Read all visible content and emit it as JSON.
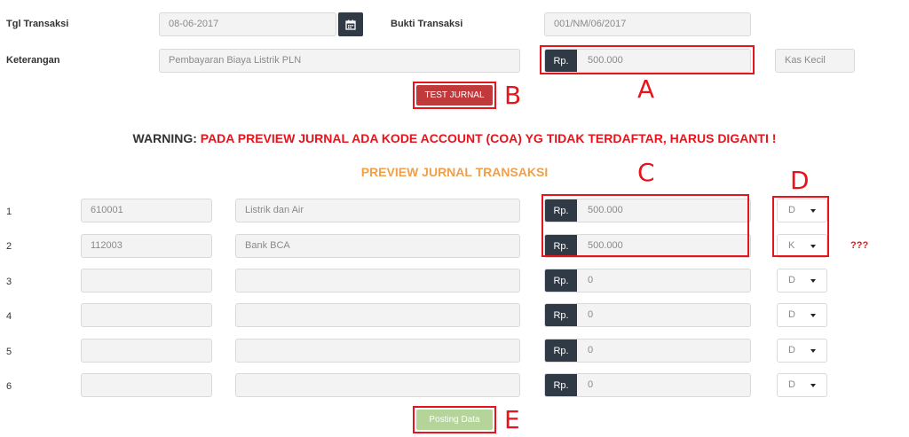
{
  "header": {
    "tgl_label": "Tgl Transaksi",
    "tgl_value": "08-06-2017",
    "bukti_label": "Bukti Transaksi",
    "bukti_value": "001/NM/06/2017",
    "keterangan_label": "Keterangan",
    "keterangan_value": "Pembayaran Biaya Listrik PLN",
    "currency": "Rp.",
    "amount": "500.000",
    "kas_value": "Kas Kecil"
  },
  "buttons": {
    "test_jurnal": "TEST JURNAL",
    "posting": "Posting Data"
  },
  "warning": {
    "prefix": "WARNING:",
    "message": "PADA PREVIEW JURNAL ADA KODE ACCOUNT (COA) YG TIDAK TERDAFTAR, HARUS DIGANTI !"
  },
  "preview_title": "PREVIEW JURNAL TRANSAKSI",
  "rows": [
    {
      "num": "1",
      "code": "610001",
      "account": "Listrik dan Air",
      "currency": "Rp.",
      "amount": "500.000",
      "dk": "D"
    },
    {
      "num": "2",
      "code": "112003",
      "account": "Bank BCA",
      "currency": "Rp.",
      "amount": "500.000",
      "dk": "K"
    },
    {
      "num": "3",
      "code": "",
      "account": "",
      "currency": "Rp.",
      "amount": "0",
      "dk": "D"
    },
    {
      "num": "4",
      "code": "",
      "account": "",
      "currency": "Rp.",
      "amount": "0",
      "dk": "D"
    },
    {
      "num": "5",
      "code": "",
      "account": "",
      "currency": "Rp.",
      "amount": "0",
      "dk": "D"
    },
    {
      "num": "6",
      "code": "",
      "account": "",
      "currency": "Rp.",
      "amount": "0",
      "dk": "D"
    }
  ],
  "row2_flag": "???",
  "annotations": {
    "a": "A",
    "b": "B",
    "c": "C",
    "d": "D",
    "e": "E"
  },
  "colors": {
    "dark_button": "#2f3a46",
    "warning_red": "#e8141d",
    "preview_orange": "#f0a04b",
    "annotation_red": "#e8141d",
    "test_button": "#c0393b",
    "posting_button": "#b5d49a"
  },
  "icons": {
    "calendar": "calendar-icon",
    "dropdown": "chevron-down-icon"
  }
}
